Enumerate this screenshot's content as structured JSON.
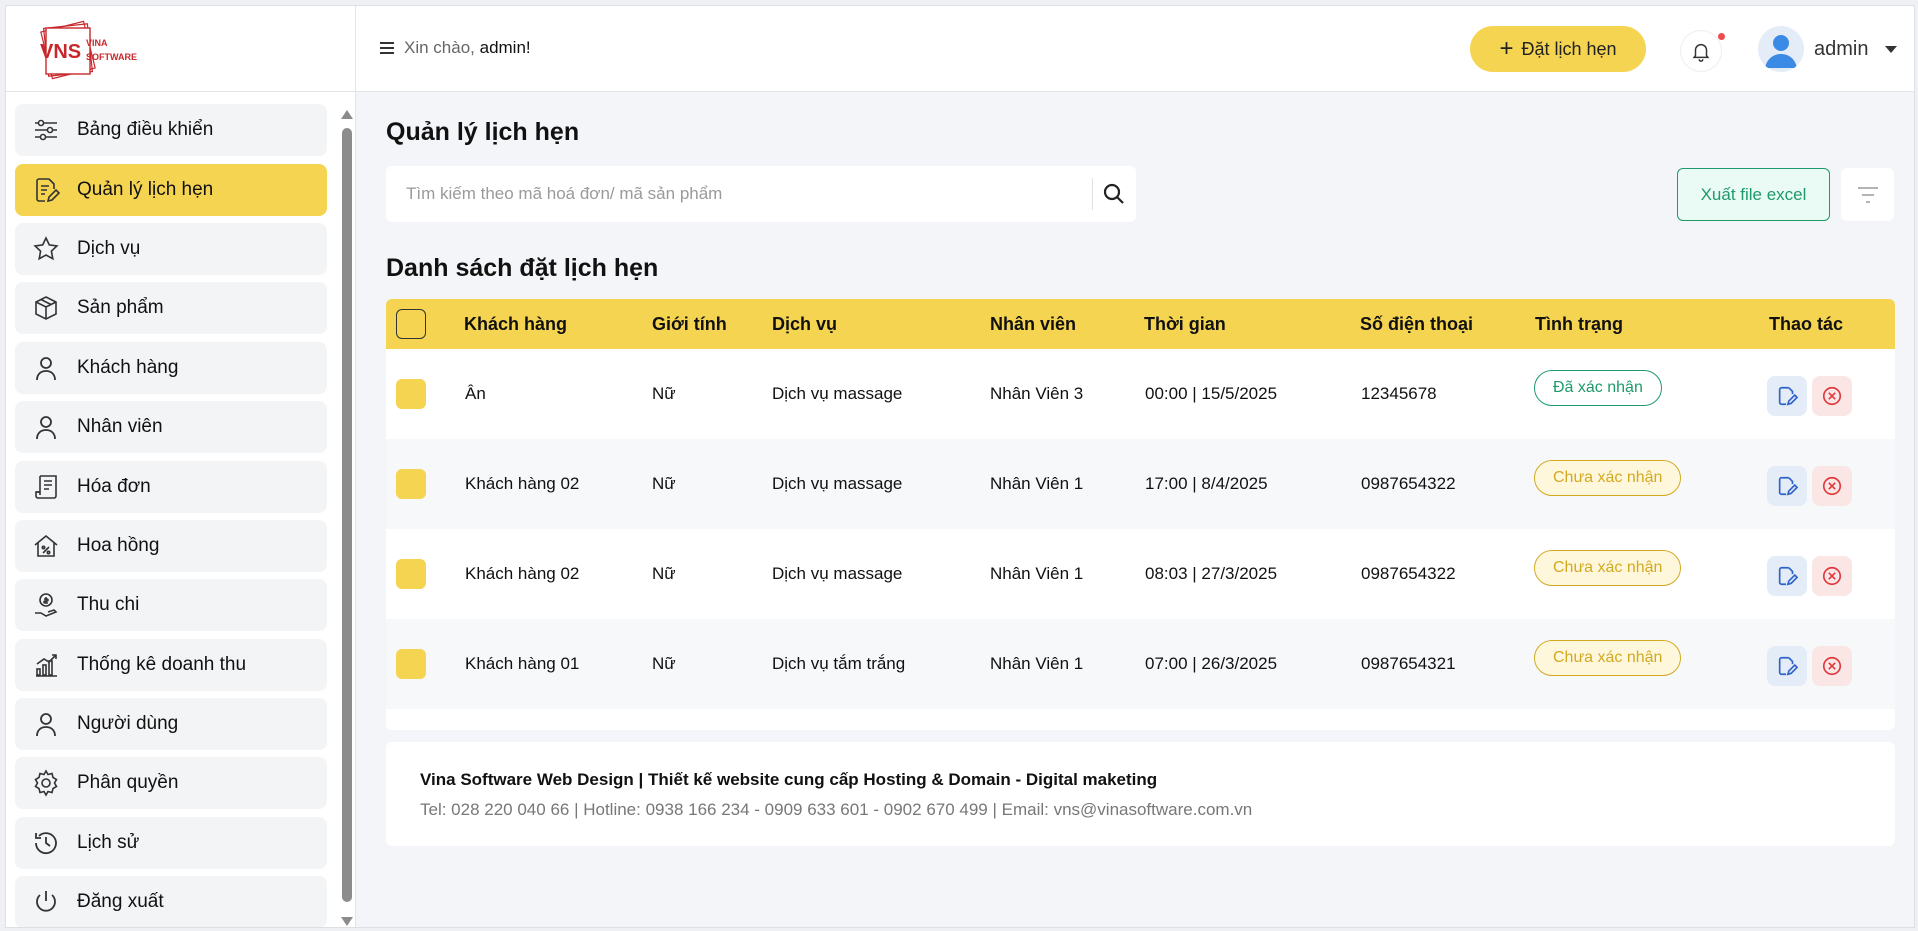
{
  "logo": {
    "mark": "VNS",
    "line1": "VINA",
    "line2": "SOFTWARE"
  },
  "header": {
    "greeting_prefix": "Xin chào, ",
    "greeting_user": "admin!",
    "book_button": "Đặt lịch hẹn",
    "user_name": "admin"
  },
  "sidebar": {
    "items": [
      {
        "label": "Bảng điều khiển",
        "icon": "sliders-icon"
      },
      {
        "label": "Quản lý lịch hẹn",
        "icon": "document-edit-icon"
      },
      {
        "label": "Dịch vụ",
        "icon": "star-icon"
      },
      {
        "label": "Sản phẩm",
        "icon": "box-icon"
      },
      {
        "label": "Khách hàng",
        "icon": "user-icon"
      },
      {
        "label": "Nhân viên",
        "icon": "user-icon"
      },
      {
        "label": "Hóa đơn",
        "icon": "receipt-icon"
      },
      {
        "label": "Hoa hồng",
        "icon": "commission-icon"
      },
      {
        "label": "Thu chi",
        "icon": "money-hand-icon"
      },
      {
        "label": "Thống kê doanh thu",
        "icon": "chart-icon"
      },
      {
        "label": "Người dùng",
        "icon": "user-icon"
      },
      {
        "label": "Phân quyền",
        "icon": "gear-icon"
      },
      {
        "label": "Lịch sử",
        "icon": "history-icon"
      },
      {
        "label": "Đăng xuất",
        "icon": "power-icon"
      }
    ],
    "active_index": 1
  },
  "main": {
    "page_title": "Quản lý lịch hẹn",
    "search_placeholder": "Tìm kiếm theo mã hoá đơn/ mã sản phẩm",
    "export_button": "Xuất file excel",
    "list_title": "Danh sách đặt lịch hẹn"
  },
  "table": {
    "columns": [
      "Khách hàng",
      "Giới tính",
      "Dịch vụ",
      "Nhân viên",
      "Thời gian",
      "Số điện thoại",
      "Tình trạng",
      "Thao tác"
    ],
    "rows": [
      {
        "customer": "Ân",
        "gender": "Nữ",
        "service": "Dịch vụ massage",
        "staff": "Nhân Viên 3",
        "time": "00:00 | 15/5/2025",
        "phone": "12345678",
        "status": "Đã xác nhận",
        "status_type": "ok"
      },
      {
        "customer": "Khách hàng 02",
        "gender": "Nữ",
        "service": "Dịch vụ massage",
        "staff": "Nhân Viên 1",
        "time": "17:00 | 8/4/2025",
        "phone": "0987654322",
        "status": "Chưa xác nhận",
        "status_type": "wait"
      },
      {
        "customer": "Khách hàng 02",
        "gender": "Nữ",
        "service": "Dịch vụ massage",
        "staff": "Nhân Viên 1",
        "time": "08:03 | 27/3/2025",
        "phone": "0987654322",
        "status": "Chưa xác nhận",
        "status_type": "wait"
      },
      {
        "customer": "Khách hàng 01",
        "gender": "Nữ",
        "service": "Dịch vụ tắm trắng",
        "staff": "Nhân Viên 1",
        "time": "07:00 | 26/3/2025",
        "phone": "0987654321",
        "status": "Chưa xác nhận",
        "status_type": "wait"
      }
    ]
  },
  "footer": {
    "title": "Vina Software Web Design | Thiết kế website cung cấp Hosting & Domain - Digital maketing",
    "contact": "Tel: 028 220 040 66 | Hotline: 0938 166 234 - 0909 633 601 - 0902 670 499 | Email: vns@vinasoftware.com.vn"
  },
  "colors": {
    "accent": "#f5d451",
    "success": "#1f9a6a",
    "warning": "#d2aa21",
    "danger": "#e0393e",
    "edit": "#2f63c9"
  }
}
